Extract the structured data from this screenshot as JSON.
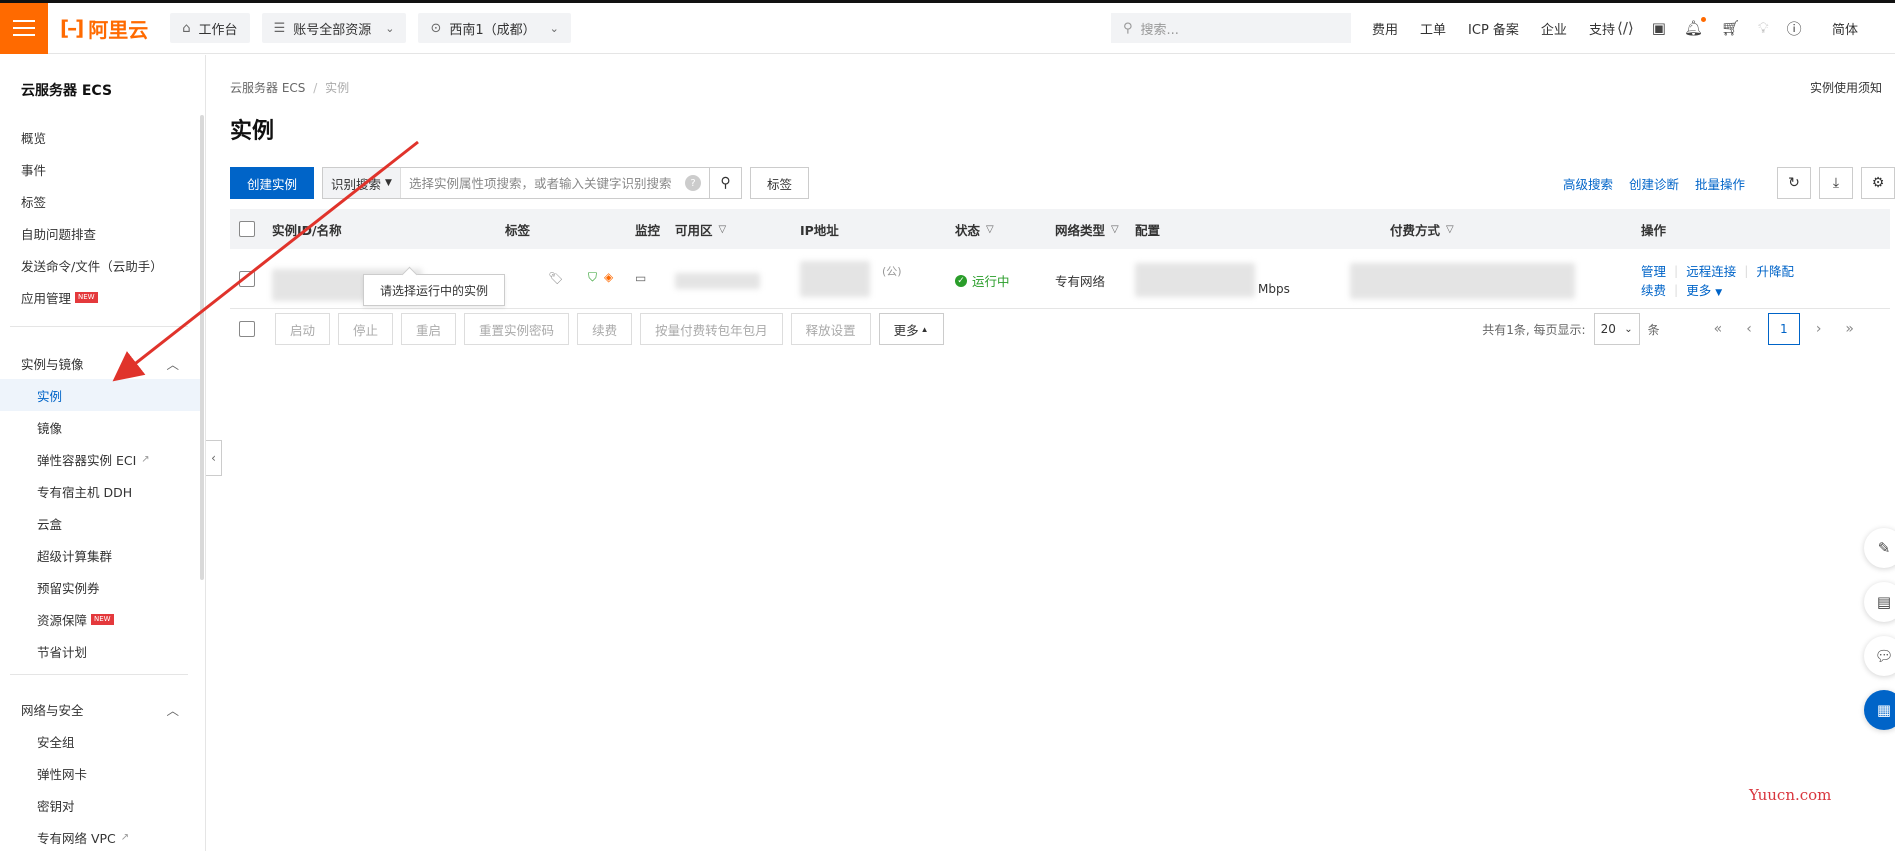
{
  "topbar": {
    "logo_text": "阿里云",
    "workbench": "工作台",
    "resource_scope": "账号全部资源",
    "region": "西南1（成都）",
    "search_placeholder": "搜索...",
    "links": [
      "费用",
      "工单",
      "ICP 备案",
      "企业",
      "支持"
    ],
    "lang": "简体"
  },
  "sidebar": {
    "title": "云服务器 ECS",
    "items": [
      "概览",
      "事件",
      "标签",
      "自助问题排查",
      "发送命令/文件（云助手）",
      "应用管理"
    ],
    "group1": {
      "label": "实例与镜像",
      "items": [
        "实例",
        "镜像",
        "弹性容器实例 ECI",
        "专有宿主机 DDH",
        "云盒",
        "超级计算集群",
        "预留实例券",
        "资源保障",
        "节省计划"
      ]
    },
    "group2": {
      "label": "网络与安全",
      "items": [
        "安全组",
        "弹性网卡",
        "密钥对",
        "专有网络 VPC"
      ]
    },
    "badge_new": "NEW"
  },
  "main": {
    "breadcrumb_root": "云服务器 ECS",
    "breadcrumb_sep": "/",
    "breadcrumb_current": "实例",
    "notice": "实例使用须知",
    "title": "实例",
    "create_button": "创建实例",
    "search_type": "识别搜索",
    "search_placeholder": "选择实例属性项搜索，或者输入关键字识别搜索",
    "tag_button": "标签",
    "advanced_search": "高级搜索",
    "create_diagnosis": "创建诊断",
    "batch_ops": "批量操作"
  },
  "table": {
    "headers": [
      "实例ID/名称",
      "标签",
      "监控",
      "可用区",
      "IP地址",
      "状态",
      "网络类型",
      "配置",
      "付费方式",
      "操作"
    ],
    "row": {
      "ip_suffix": "(公)",
      "status": "运行中",
      "network": "专有网络",
      "bandwidth": "Mbps",
      "ops": [
        "管理",
        "远程连接",
        "升降配",
        "续费",
        "更多"
      ]
    },
    "tooltip": "请选择运行中的实例"
  },
  "batch": {
    "buttons": [
      "启动",
      "停止",
      "重启",
      "重置实例密码",
      "续费",
      "按量付费转包年包月",
      "释放设置"
    ],
    "more": "更多"
  },
  "pager": {
    "summary": "共有1条, 每页显示:",
    "page_size": "20",
    "unit": "条",
    "current_page": "1"
  },
  "watermark": "Yuucn.com",
  "colors": {
    "brand": "#ff6a00",
    "primary": "#0064c8",
    "success": "#2a9d2a",
    "arrow": "#e0332b"
  }
}
